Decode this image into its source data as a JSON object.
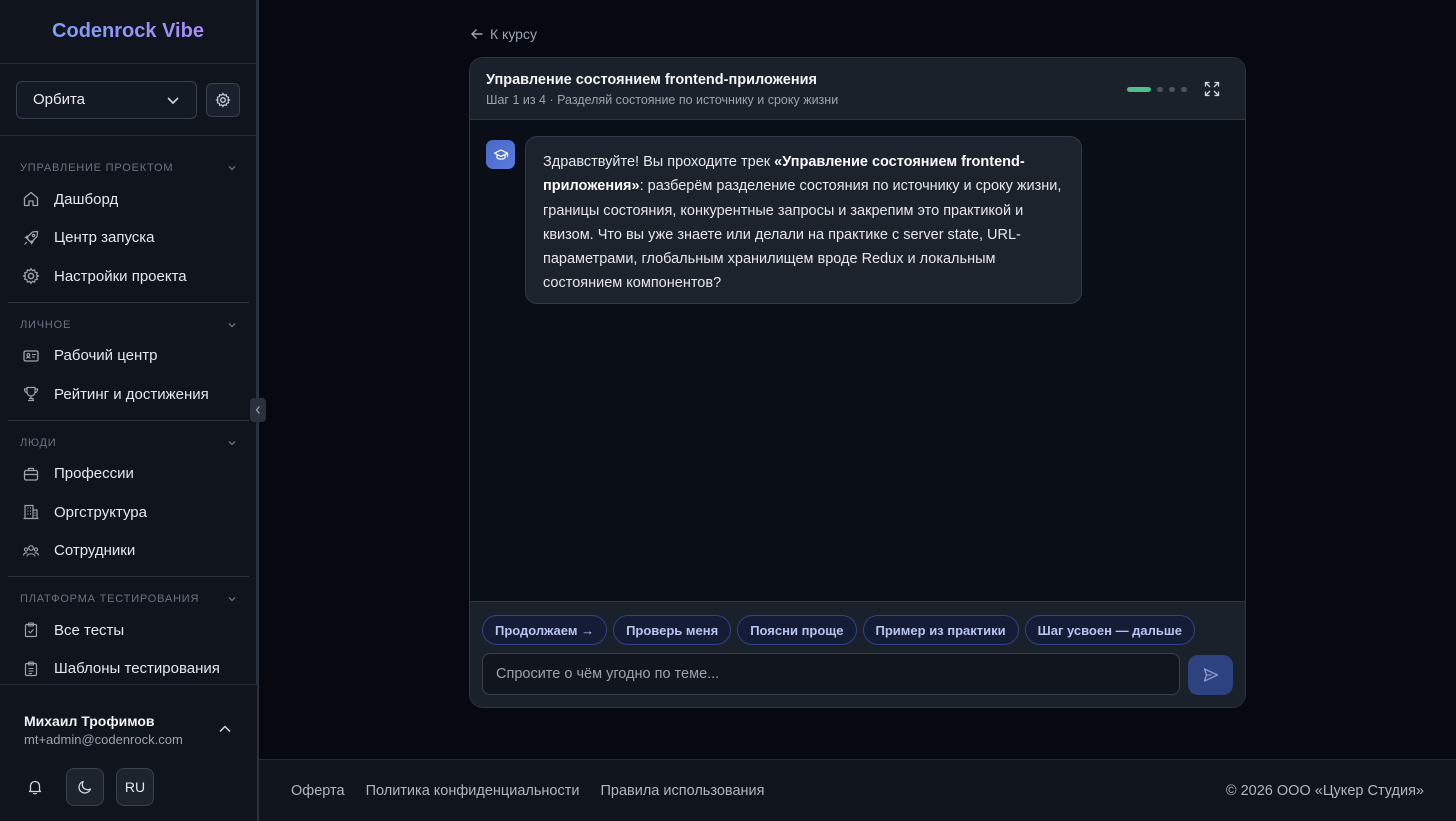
{
  "brand": "Codenrock Vibe",
  "project": {
    "selected": "Орбита"
  },
  "sidebar": {
    "sections": [
      {
        "title": "УПРАВЛЕНИЕ ПРОЕКТОМ",
        "items": [
          "Дашборд",
          "Центр запуска",
          "Настройки проекта"
        ]
      },
      {
        "title": "ЛИЧНОЕ",
        "items": [
          "Рабочий центр",
          "Рейтинг и достижения"
        ]
      },
      {
        "title": "ЛЮДИ",
        "items": [
          "Профессии",
          "Оргструктура",
          "Сотрудники"
        ]
      },
      {
        "title": "ПЛАТФОРМА ТЕСТИРОВАНИЯ",
        "items": [
          "Все тесты",
          "Шаблоны тестирования"
        ]
      }
    ]
  },
  "user": {
    "name": "Михаил Трофимов",
    "email": "mt+admin@codenrock.com",
    "lang": "RU"
  },
  "back_label": "К курсу",
  "course": {
    "title": "Управление состоянием frontend-приложения",
    "subtitle": "Шаг 1 из 4 · Разделяй состояние по источнику и сроку жизни",
    "progress_steps": 4,
    "current_step": 1
  },
  "message": {
    "intro": "Здравствуйте! Вы проходите трек ",
    "bold": "«Управление состоянием frontend-приложения»",
    "rest": ": разберём разделение состояния по источнику и сроку жизни, границы состояния, конкурентные запросы и закрепим это практикой и квизом. Что вы уже знаете или делали на практике с server state, URL-параметрами, глобальным хранилищем вроде Redux и локальным состоянием компонентов?"
  },
  "chips": [
    "Продолжаем →",
    "Проверь меня",
    "Поясни проще",
    "Пример из практики",
    "Шаг усвоен — дальше"
  ],
  "composer": {
    "placeholder": "Спросите о чём угодно по теме..."
  },
  "footer": {
    "links": [
      "Оферта",
      "Политика конфиденциальности",
      "Правила использования"
    ],
    "copyright": "© 2026 ООО «Цукер Студия»"
  },
  "colors": {
    "accent": "#4fbf8b",
    "chip_border": "#334287",
    "send_bg": "#2d4380"
  }
}
